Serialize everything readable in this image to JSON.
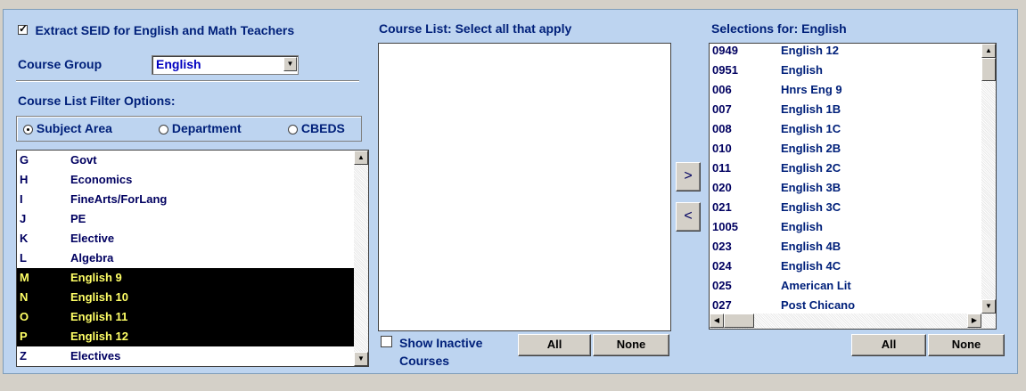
{
  "extract": {
    "label": "Extract SEID for English and Math Teachers",
    "checked": true
  },
  "course_group": {
    "label": "Course Group",
    "value": "English"
  },
  "filter": {
    "label": "Course List Filter Options:",
    "options": [
      "Subject Area",
      "Department",
      "CBEDS"
    ],
    "selected": "Subject Area"
  },
  "subject_list": [
    {
      "code": "G",
      "name": "Govt",
      "selected": false
    },
    {
      "code": "H",
      "name": "Economics",
      "selected": false
    },
    {
      "code": "I",
      "name": "FineArts/ForLang",
      "selected": false
    },
    {
      "code": "J",
      "name": "PE",
      "selected": false
    },
    {
      "code": "K",
      "name": "Elective",
      "selected": false
    },
    {
      "code": "L",
      "name": "Algebra",
      "selected": false
    },
    {
      "code": "M",
      "name": "English 9",
      "selected": true
    },
    {
      "code": "N",
      "name": "English 10",
      "selected": true
    },
    {
      "code": "O",
      "name": "English 11",
      "selected": true
    },
    {
      "code": "P",
      "name": "English 12",
      "selected": true
    },
    {
      "code": "Z",
      "name": "Electives",
      "selected": false
    }
  ],
  "course_list": {
    "label": "Course List: Select all that apply",
    "items": []
  },
  "show_inactive": {
    "label_line1": "Show Inactive",
    "label_line2": "Courses",
    "checked": false
  },
  "buttons": {
    "all": "All",
    "none": "None",
    "add": ">",
    "remove": "<"
  },
  "selections": {
    "label": "Selections for:  English",
    "items": [
      {
        "code": "0949",
        "name": "English 12"
      },
      {
        "code": "0951",
        "name": "English"
      },
      {
        "code": "006",
        "name": "Hnrs Eng 9"
      },
      {
        "code": "007",
        "name": "English 1B"
      },
      {
        "code": "008",
        "name": "English 1C"
      },
      {
        "code": "010",
        "name": "English 2B"
      },
      {
        "code": "011",
        "name": "English 2C"
      },
      {
        "code": "020",
        "name": "English 3B"
      },
      {
        "code": "021",
        "name": "English 3C"
      },
      {
        "code": "1005",
        "name": "English"
      },
      {
        "code": "023",
        "name": "English 4B"
      },
      {
        "code": "024",
        "name": "English 4C"
      },
      {
        "code": "025",
        "name": "American Lit"
      },
      {
        "code": "027",
        "name": "Post Chicano"
      }
    ]
  },
  "icons": {
    "check": "checkmark-icon",
    "arrow_up": "arrow-up-icon",
    "arrow_down": "arrow-down-icon",
    "arrow_left": "arrow-left-icon",
    "arrow_right": "arrow-right-icon"
  }
}
